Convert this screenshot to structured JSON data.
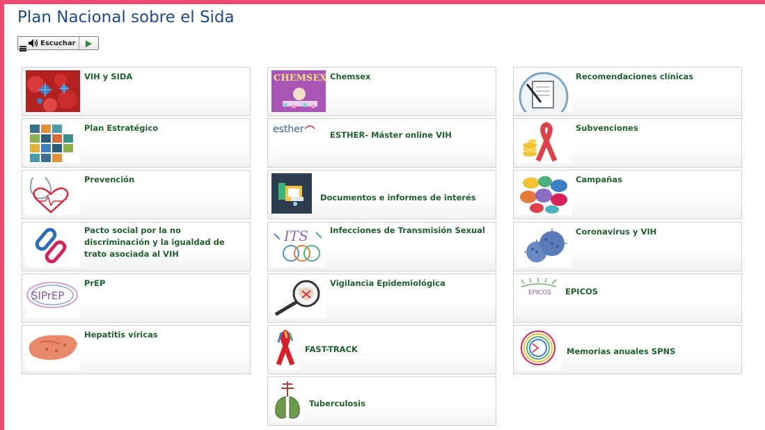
{
  "page": {
    "title": "Plan Nacional sobre el Sida",
    "accent_color": "#ef4a6f",
    "title_color": "#1d4a8a",
    "label_color": "#1f5f2e"
  },
  "toolbar": {
    "listen_label": "Escuchar"
  },
  "tiles": [
    {
      "label": "VIH y SIDA",
      "icon": "virus-cells-icon"
    },
    {
      "label": "Plan Estratégico",
      "icon": "puzzle-icon"
    },
    {
      "label": "Prevención",
      "icon": "stethoscope-heart-icon"
    },
    {
      "label": "Pacto social por la no discriminación y la igualdad de trato asociada al VIH",
      "icon": "chain-link-icon"
    },
    {
      "label": "PrEP",
      "icon": "siprep-logo-icon"
    },
    {
      "label": "Hepatitis víricas",
      "icon": "liver-icon"
    },
    {
      "label": "Chemsex",
      "icon": "chemsex-logo-icon"
    },
    {
      "label": "ESTHER- Máster online VIH",
      "icon": "esther-logo-icon"
    },
    {
      "label": "Documentos e informes de interés",
      "icon": "folder-documents-icon"
    },
    {
      "label": "Infecciones de Transmisión Sexual",
      "icon": "its-logo-icon"
    },
    {
      "label": "Vigilancia Epidemiológica",
      "icon": "magnifier-map-icon"
    },
    {
      "label": "FAST-TRACK",
      "icon": "ribbons-icon"
    },
    {
      "label": "Tuberculosis",
      "icon": "lungs-cross-icon"
    },
    {
      "label": "Recomendaciones clínicas",
      "icon": "document-pen-icon"
    },
    {
      "label": "Subvenciones",
      "icon": "ribbon-coins-icon"
    },
    {
      "label": "Campañas",
      "icon": "speech-bubbles-icon"
    },
    {
      "label": "Coronavirus y VIH",
      "icon": "coronavirus-icon"
    },
    {
      "label": "EPICOS",
      "icon": "epicos-logo-icon"
    },
    {
      "label": "Memorias anuales SPNS",
      "icon": "circle-arrows-icon"
    }
  ]
}
